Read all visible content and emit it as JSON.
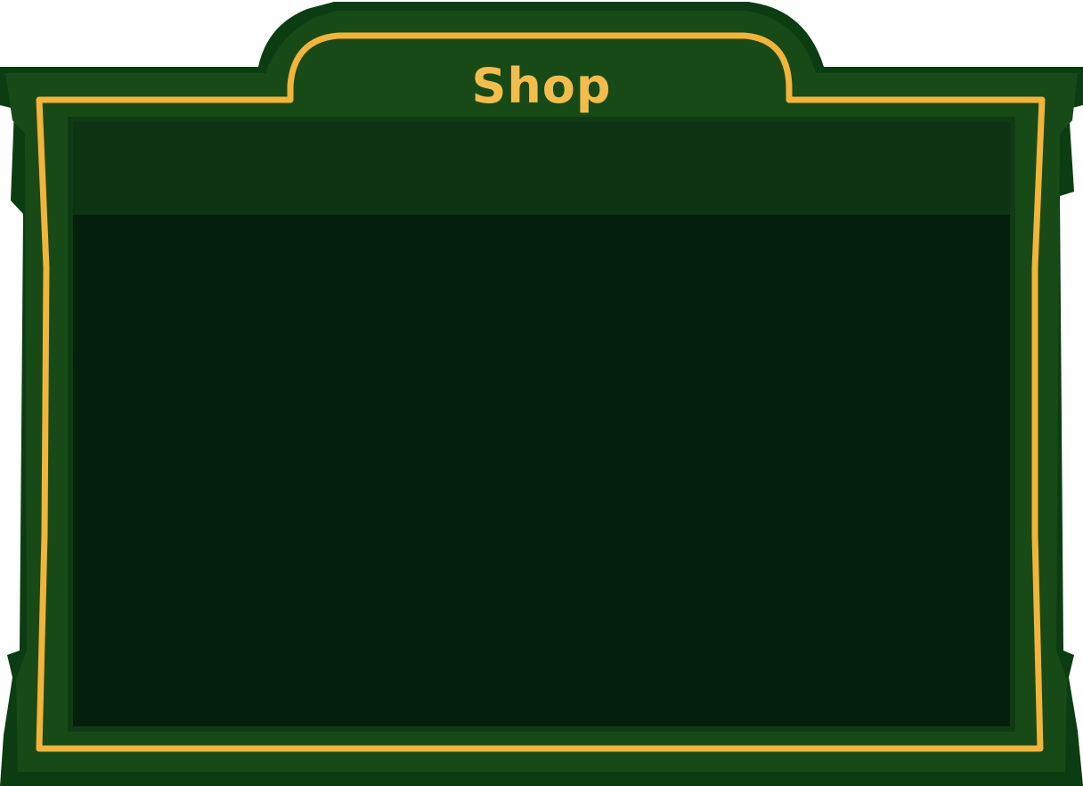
{
  "panel": {
    "title": "Shop"
  },
  "colors": {
    "outer_border": "#0c3d12",
    "panel_green": "#174a17",
    "gold_trim": "#f2b43a",
    "header_strip": "#0c3412",
    "content_bg": "#04200c",
    "title_text": "#f2bd4d"
  }
}
